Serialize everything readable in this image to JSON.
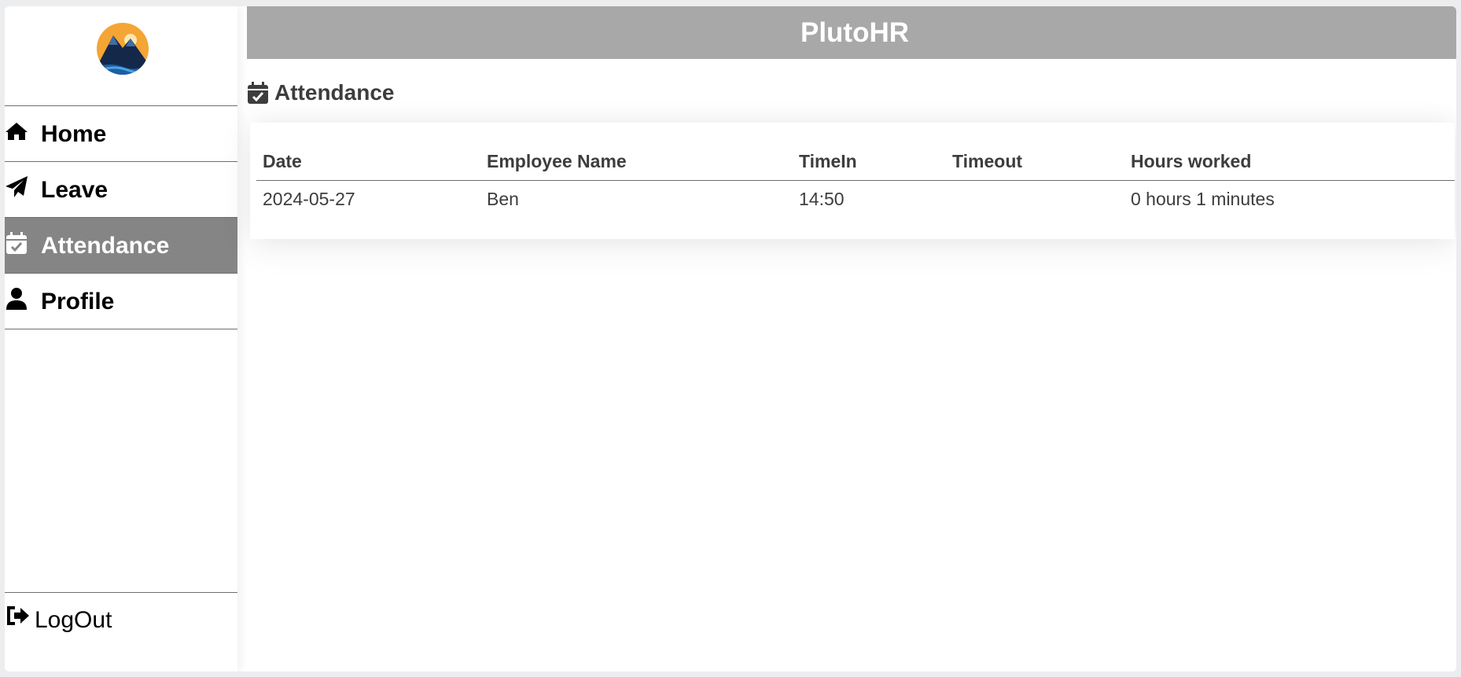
{
  "app": {
    "title": "PlutoHR"
  },
  "sidebar": {
    "logo": "mountain-sunset-logo",
    "items": [
      {
        "label": "Home",
        "icon": "home-icon",
        "active": false
      },
      {
        "label": "Leave",
        "icon": "paper-plane-icon",
        "active": false
      },
      {
        "label": "Attendance",
        "icon": "calendar-check-icon",
        "active": true
      },
      {
        "label": "Profile",
        "icon": "user-icon",
        "active": false
      }
    ],
    "logout": {
      "label": "LogOut",
      "icon": "sign-out-icon"
    }
  },
  "page": {
    "title": "Attendance",
    "icon": "calendar-check-icon"
  },
  "table": {
    "columns": [
      "Date",
      "Employee Name",
      "TimeIn",
      "Timeout",
      "Hours worked"
    ],
    "rows": [
      [
        "2024-05-27",
        "Ben",
        "14:50",
        "",
        "0 hours 1 minutes"
      ]
    ]
  },
  "colors": {
    "topbar": "#a9a8a8",
    "active_nav": "#858585",
    "text_dark": "#3d3d3d"
  }
}
